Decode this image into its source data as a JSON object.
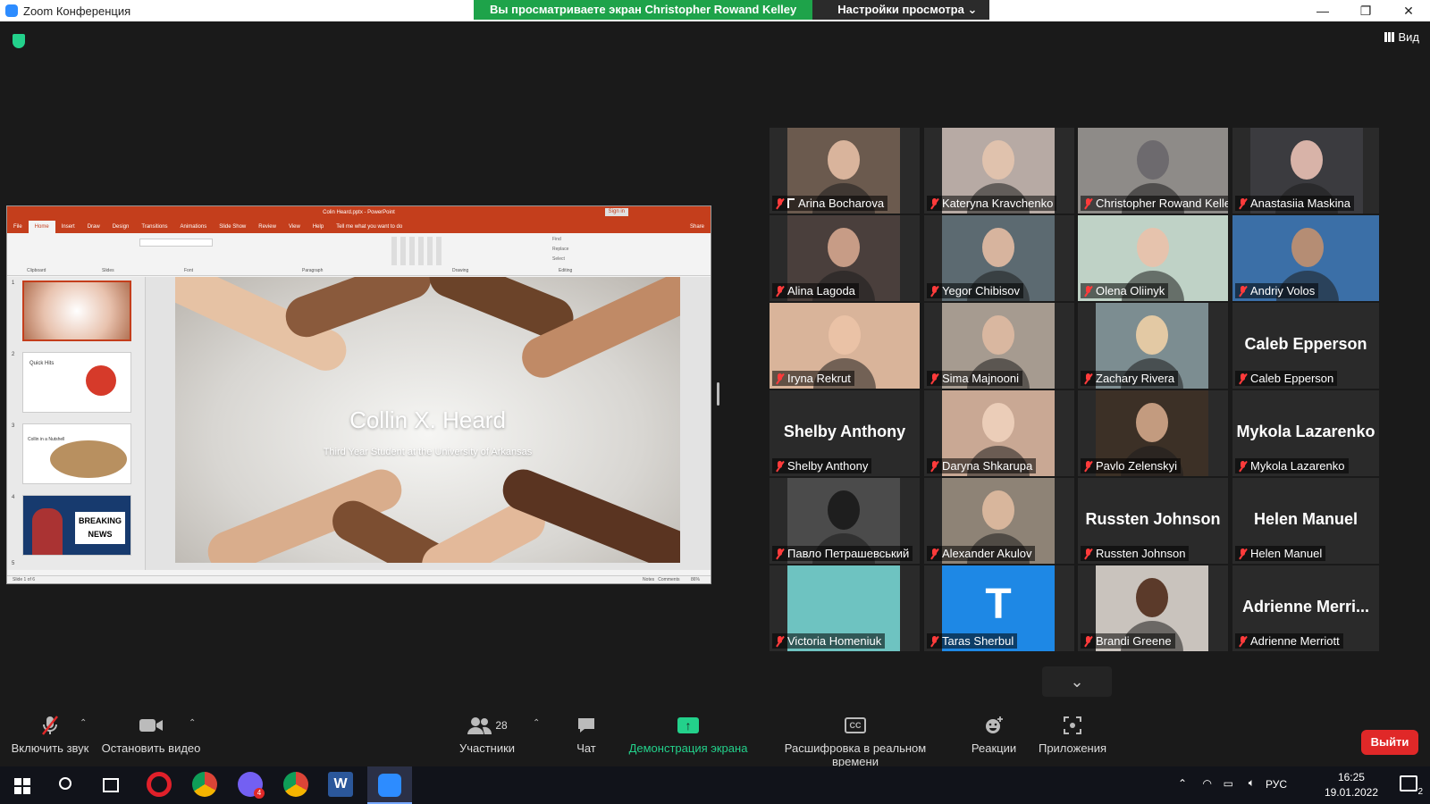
{
  "window": {
    "title": "Zoom Конференция",
    "share_banner": "Вы просматриваете экран Christopher Rowand Kelley",
    "view_options": "Настройки просмотра ⌄",
    "minimize": "—",
    "restore": "❐",
    "close": "✕"
  },
  "view_button": "Вид",
  "powerpoint": {
    "title": "Colin Heard.pptx - PowerPoint",
    "signin": "Sign in",
    "tabs": [
      "File",
      "Home",
      "Insert",
      "Draw",
      "Design",
      "Transitions",
      "Animations",
      "Slide Show",
      "Review",
      "View",
      "Help",
      "Tell me what you want to do"
    ],
    "share": "Share",
    "groups": [
      "Clipboard",
      "Slides",
      "Font",
      "Paragraph",
      "Drawing",
      "Editing"
    ],
    "ribbon_editing": [
      "Find",
      "Replace",
      "Select"
    ],
    "slide_title": "Collin X. Heard",
    "slide_subtitle": "Third Year Student at the University of Arkansas",
    "thumb_numbers": [
      "1",
      "2",
      "3",
      "4",
      "5"
    ],
    "thumb2_title": "Quick Hits",
    "thumb3_title": "Collin in a Nutshell",
    "thumb4_text": "BREAKING NEWS",
    "status_left": "Slide 1 of 6",
    "status_notes": "Notes",
    "status_comments": "Comments",
    "zoom": "86%"
  },
  "participants": [
    {
      "name": "Arina Bocharova",
      "pinned": true,
      "video": "#6b5a4e",
      "face": "#d9b49c"
    },
    {
      "name": "Kateryna Kravchenko",
      "video": "#b7aaa4",
      "face": "#e0c2ad"
    },
    {
      "name": "Christopher Rowand Kelley",
      "video": "#8e8b88",
      "face": "#6d6a6e",
      "active": true
    },
    {
      "name": "Anastasiia Maskina",
      "video": "#3b3b3f",
      "face": "#d8b3a8"
    },
    {
      "name": "Alina Lagoda",
      "video": "#4a3f3c",
      "face": "#c79c86"
    },
    {
      "name": "Yegor Chibisov",
      "video": "#5c6a71",
      "face": "#d7b49e"
    },
    {
      "name": "Olena Oliinyk",
      "video": "#bfd2c6",
      "face": "#e6c3ad"
    },
    {
      "name": "Andriy Volos",
      "video": "#3b6fa7",
      "face": "#b58d74"
    },
    {
      "name": "Iryna Rekrut",
      "video": "#d9b49a",
      "face": "#eac2a6"
    },
    {
      "name": "Sima Majnooni",
      "video": "#a69b90",
      "face": "#d9b7a0"
    },
    {
      "name": "Zachary Rivera",
      "video": "#7c8d91",
      "face": "#e3c9a4"
    },
    {
      "name": "Caleb Epperson",
      "video": "",
      "face": ""
    },
    {
      "name": "Shelby Anthony",
      "video": "",
      "face": ""
    },
    {
      "name": "Daryna Shkarupa",
      "video": "#c9a894",
      "face": "#ebcdb8"
    },
    {
      "name": "Pavlo Zelenskyi",
      "video": "#3c3026",
      "face": "#c39b7f"
    },
    {
      "name": "Mykola Lazarenko",
      "video": "",
      "face": ""
    },
    {
      "name": "Павло Петрашевський",
      "video": "#4b4b4b",
      "face": "#1e1e1e"
    },
    {
      "name": "Alexander Akulov",
      "video": "#8e8376",
      "face": "#d8b69c"
    },
    {
      "name": "Russten Johnson",
      "video": "",
      "face": ""
    },
    {
      "name": "Helen Manuel",
      "video": "",
      "face": ""
    },
    {
      "name": "Victoria Homeniuk",
      "video": "#6ec3c1",
      "face": ""
    },
    {
      "name": "Taras Sherbul",
      "video": "#1e88e5",
      "face": "",
      "letter": "T"
    },
    {
      "name": "Brandi Greene",
      "video": "#c9c3bd",
      "face": "#5b3a2a"
    },
    {
      "name": "Adrienne Merriott",
      "video": "",
      "face": "",
      "big": "Adrienne  Merri..."
    }
  ],
  "toolbar": {
    "unmute": "Включить звук",
    "stop_video": "Остановить видео",
    "participants": "Участники",
    "participants_count": "28",
    "chat": "Чат",
    "share_screen": "Демонстрация экрана",
    "captions": "Расшифровка в реальном времени",
    "reactions": "Реакции",
    "apps": "Приложения",
    "leave": "Выйти",
    "cc": "CC"
  },
  "taskbar": {
    "lang": "РУС",
    "time": "16:25",
    "date": "19.01.2022",
    "notifications": "2",
    "viber_badge": "4"
  }
}
